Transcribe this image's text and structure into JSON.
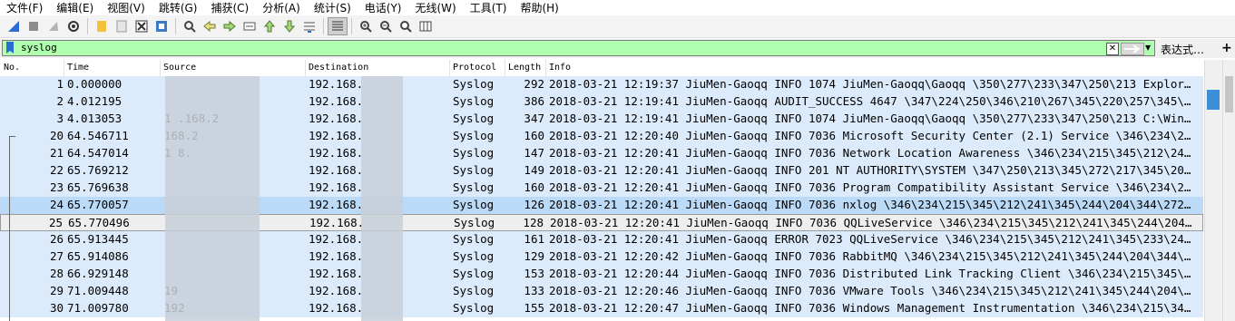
{
  "menu": [
    "文件(F)",
    "编辑(E)",
    "视图(V)",
    "跳转(G)",
    "捕获(C)",
    "分析(A)",
    "统计(S)",
    "电话(Y)",
    "无线(W)",
    "工具(T)",
    "帮助(H)"
  ],
  "toolbar_icons": [
    "shark-fin-start-icon",
    "stop-icon",
    "restart-icon",
    "capture-options-icon",
    "open-file-icon",
    "save-file-icon",
    "close-file-icon",
    "reload-file-icon",
    "find-packet-icon",
    "go-back-icon",
    "go-forward-icon",
    "go-to-packet-icon",
    "first-packet-icon",
    "last-packet-icon",
    "autoscroll-icon",
    "colorize-icon",
    "zoom-in-icon",
    "zoom-out-icon",
    "zoom-normal-icon",
    "resize-columns-icon"
  ],
  "filter": {
    "value": "syslog",
    "expression_label": "表达式…",
    "plus": "+",
    "clear": "✕"
  },
  "columns": [
    "No.",
    "Time",
    "Source",
    "Destination",
    "Protocol",
    "Length",
    "Info"
  ],
  "packets": [
    {
      "no": "1",
      "time": "0.000000",
      "src": "",
      "dst": "192.168.",
      "proto": "Syslog",
      "len": "292",
      "info": "2018-03-21 12:19:37 JiuMen-Gaoqq INFO 1074 JiuMen-Gaoqq\\Gaoqq \\350\\277\\233\\347\\250\\213 Explor…"
    },
    {
      "no": "2",
      "time": "4.012195",
      "src": "",
      "dst": "192.168.",
      "proto": "Syslog",
      "len": "386",
      "info": "2018-03-21 12:19:41 JiuMen-Gaoqq AUDIT_SUCCESS 4647 \\347\\224\\250\\346\\210\\267\\345\\220\\257\\345\\…"
    },
    {
      "no": "3",
      "time": "4.013053",
      "src": "1  .168.2",
      "dst": "192.168.",
      "proto": "Syslog",
      "len": "347",
      "info": "2018-03-21 12:19:41 JiuMen-Gaoqq INFO 1074 JiuMen-Gaoqq\\Gaoqq \\350\\277\\233\\347\\250\\213 C:\\Win…"
    },
    {
      "no": "20",
      "time": "64.546711",
      "src": "   168.2",
      "dst": "192.168.",
      "proto": "Syslog",
      "len": "160",
      "info": "2018-03-21 12:20:40 JiuMen-Gaoqq INFO 7036 Microsoft Security Center (2.1) Service \\346\\234\\2…"
    },
    {
      "no": "21",
      "time": "64.547014",
      "src": "1    8.",
      "dst": "192.168.",
      "proto": "Syslog",
      "len": "147",
      "info": "2018-03-21 12:20:41 JiuMen-Gaoqq INFO 7036 Network Location Awareness \\346\\234\\215\\345\\212\\24…"
    },
    {
      "no": "22",
      "time": "65.769212",
      "src": "",
      "dst": "192.168.",
      "proto": "Syslog",
      "len": "149",
      "info": "2018-03-21 12:20:41 JiuMen-Gaoqq INFO 201 NT AUTHORITY\\SYSTEM \\347\\250\\213\\345\\272\\217\\345\\20…"
    },
    {
      "no": "23",
      "time": "65.769638",
      "src": "",
      "dst": "192.168.",
      "proto": "Syslog",
      "len": "160",
      "info": "2018-03-21 12:20:41 JiuMen-Gaoqq INFO 7036 Program Compatibility Assistant Service \\346\\234\\2…"
    },
    {
      "no": "24",
      "time": "65.770057",
      "src": "",
      "dst": "192.168.",
      "proto": "Syslog",
      "len": "126",
      "info": "2018-03-21 12:20:41 JiuMen-Gaoqq INFO 7036 nxlog \\346\\234\\215\\345\\212\\241\\345\\244\\204\\344\\272…"
    },
    {
      "no": "25",
      "time": "65.770496",
      "src": "",
      "dst": "192.168.",
      "proto": "Syslog",
      "len": "128",
      "info": "2018-03-21 12:20:41 JiuMen-Gaoqq INFO 7036 QQLiveService \\346\\234\\215\\345\\212\\241\\345\\244\\204…"
    },
    {
      "no": "26",
      "time": "65.913445",
      "src": "",
      "dst": "192.168.",
      "proto": "Syslog",
      "len": "161",
      "info": "2018-03-21 12:20:41 JiuMen-Gaoqq ERROR 7023 QQLiveService \\346\\234\\215\\345\\212\\241\\345\\233\\24…"
    },
    {
      "no": "27",
      "time": "65.914086",
      "src": "",
      "dst": "192.168.",
      "proto": "Syslog",
      "len": "129",
      "info": "2018-03-21 12:20:42 JiuMen-Gaoqq INFO 7036 RabbitMQ \\346\\234\\215\\345\\212\\241\\345\\244\\204\\344\\…"
    },
    {
      "no": "28",
      "time": "66.929148",
      "src": "",
      "dst": "192.168.",
      "proto": "Syslog",
      "len": "153",
      "info": "2018-03-21 12:20:44 JiuMen-Gaoqq INFO 7036 Distributed Link Tracking Client \\346\\234\\215\\345\\…"
    },
    {
      "no": "29",
      "time": "71.009448",
      "src": "19",
      "dst": "192.168.",
      "proto": "Syslog",
      "len": "133",
      "info": "2018-03-21 12:20:46 JiuMen-Gaoqq INFO 7036 VMware Tools \\346\\234\\215\\345\\212\\241\\345\\244\\204\\…"
    },
    {
      "no": "30",
      "time": "71.009780",
      "src": "192",
      "dst": "192.168.",
      "proto": "Syslog",
      "len": "155",
      "info": "2018-03-21 12:20:47 JiuMen-Gaoqq INFO 7036 Windows Management Instrumentation \\346\\234\\215\\34…"
    }
  ],
  "colors": {
    "row_bg": "#dcebfc",
    "selected_row_bg": "#bbdaf7",
    "filter_ok_bg": "#afffaf"
  }
}
